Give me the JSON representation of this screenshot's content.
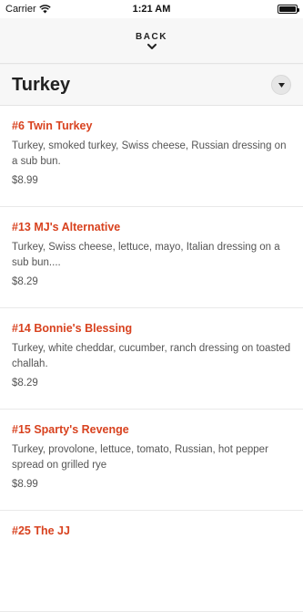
{
  "status_bar": {
    "carrier": "Carrier",
    "time": "1:21 AM"
  },
  "nav": {
    "back_label": "BACK"
  },
  "section": {
    "title": "Turkey"
  },
  "items": [
    {
      "name": "#6 Twin Turkey",
      "description": "Turkey, smoked turkey, Swiss cheese, Russian dressing on a sub bun.",
      "price": "$8.99"
    },
    {
      "name": "#13 MJ's Alternative",
      "description": "Turkey, Swiss cheese, lettuce, mayo, Italian dressing on a sub bun....",
      "price": "$8.29"
    },
    {
      "name": "#14 Bonnie's Blessing",
      "description": "Turkey, white cheddar, cucumber, ranch dressing on toasted challah.",
      "price": "$8.29"
    },
    {
      "name": "#15 Sparty's Revenge",
      "description": "Turkey, provolone, lettuce, tomato, Russian, hot pepper spread on grilled rye",
      "price": "$8.99"
    },
    {
      "name": "#25 The JJ",
      "description": "",
      "price": ""
    }
  ],
  "colors": {
    "accent": "#d8421f"
  }
}
